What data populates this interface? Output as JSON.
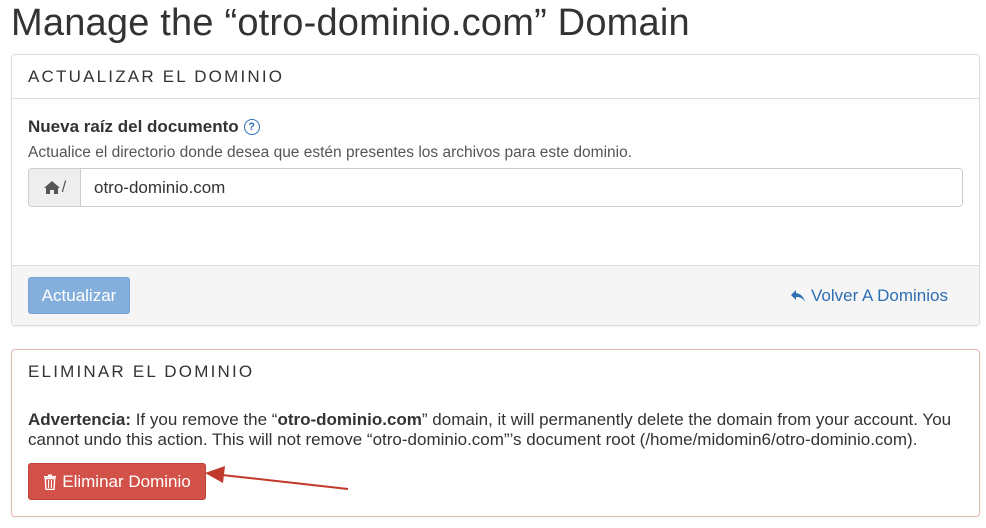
{
  "page_title": "Manage the “otro-dominio.com” Domain",
  "update_panel": {
    "heading": "ACTUALIZAR EL DOMINIO",
    "field_label": "Nueva raíz del documento",
    "help_icon": "question-circle-icon",
    "field_help": "Actualice el directorio donde desea que estén presentes los archivos para este dominio.",
    "addon_icon": "home-icon",
    "addon_text": "/",
    "document_root_value": "otro-dominio.com",
    "update_button": "Actualizar",
    "back_icon": "reply-arrow-icon",
    "back_link": "Volver A Dominios"
  },
  "delete_panel": {
    "heading": "ELIMINAR EL DOMINIO",
    "warning_label": "Advertencia:",
    "warning_text_1": " If you remove the “",
    "warning_domain": "otro-dominio.com",
    "warning_text_2": "” domain, it will permanently delete the domain from your account. You cannot undo this action. This will not remove “otro-dominio.com”’s document root (/home/midomin6/otro-dominio.com).",
    "delete_icon": "trash-icon",
    "delete_button": "Eliminar Dominio"
  },
  "colors": {
    "primary_link": "#2e6fb4",
    "update_button_bg": "#84aedb",
    "delete_button_bg": "#d2524a",
    "annotation_arrow": "#c0392b"
  }
}
